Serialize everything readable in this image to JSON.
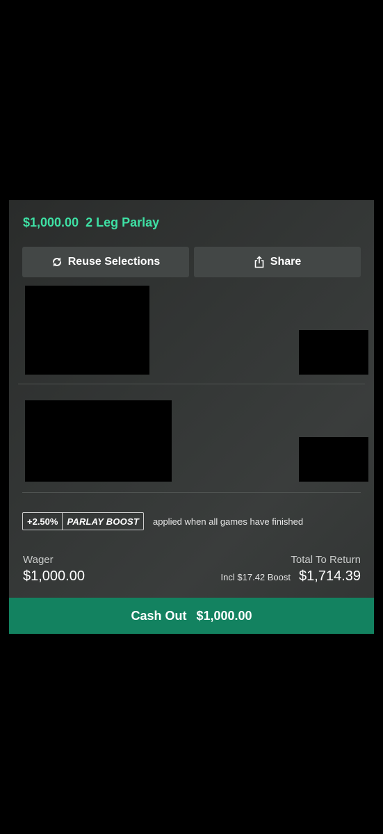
{
  "bet": {
    "stake": "$1,000.00",
    "type": "2 Leg Parlay"
  },
  "actions": {
    "reuse_label": "Reuse Selections",
    "reuse_icon": "refresh-icon",
    "share_label": "Share",
    "share_icon": "share-icon"
  },
  "boost": {
    "percent": "+2.50%",
    "label": "PARLAY BOOST",
    "note": "applied when all games have finished"
  },
  "summary": {
    "wager_label": "Wager",
    "wager_value": "$1,000.00",
    "return_label": "Total To Return",
    "boost_incl": "Incl $17.42 Boost",
    "return_value": "$1,714.39"
  },
  "cashout": {
    "label": "Cash Out",
    "amount": "$1,000.00"
  },
  "colors": {
    "accent_green": "#3ee0a4",
    "cashout_bg": "#138260",
    "card_bg": "#343736"
  }
}
